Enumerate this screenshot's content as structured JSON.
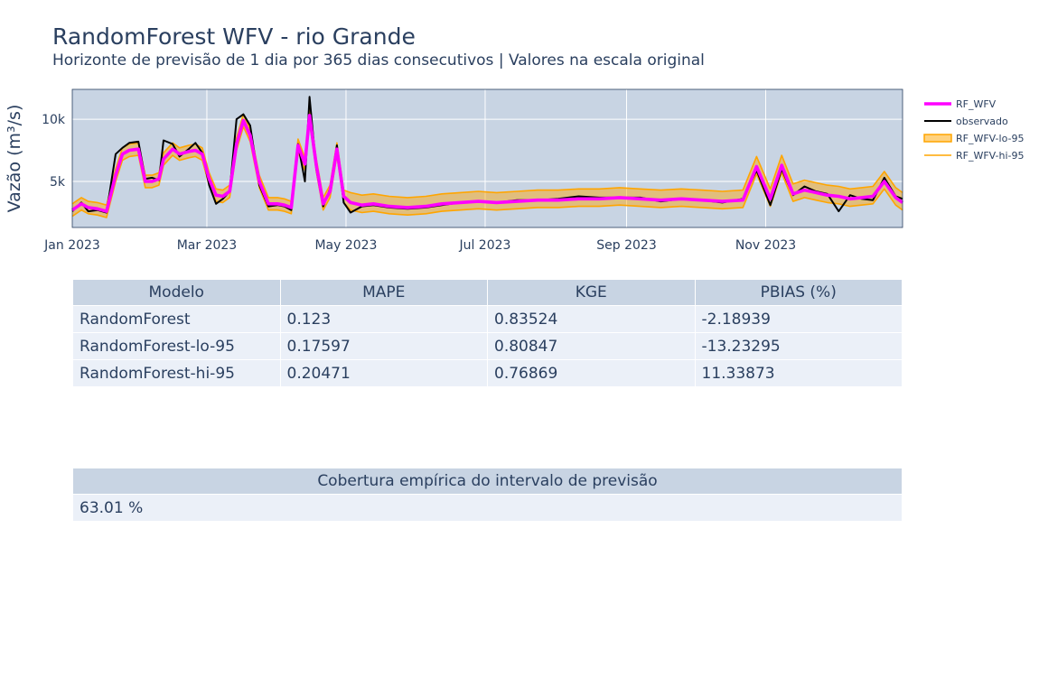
{
  "title": "RandomForest WFV - rio Grande",
  "subtitle": "Horizonte de previsão de 1 dia por 365 dias consecutivos | Valores na escala original",
  "chart_data": {
    "type": "line",
    "title": "RandomForest WFV - rio Grande",
    "subtitle": "Horizonte de previsão de 1 dia por 365 dias consecutivos | Valores na escala original",
    "ylabel": "Vazão (m³/s)",
    "xlabel": "",
    "x_range": [
      "2023-01-01",
      "2023-12-31"
    ],
    "ylim": [
      1300,
      12400
    ],
    "x_ticks": [
      {
        "date": "2023-01-01",
        "label": "Jan 2023"
      },
      {
        "date": "2023-03-01",
        "label": "Mar 2023"
      },
      {
        "date": "2023-05-01",
        "label": "May 2023"
      },
      {
        "date": "2023-07-01",
        "label": "Jul 2023"
      },
      {
        "date": "2023-09-01",
        "label": "Sep 2023"
      },
      {
        "date": "2023-11-01",
        "label": "Nov 2023"
      }
    ],
    "y_ticks": [
      {
        "value": 5000,
        "label": "5k"
      },
      {
        "value": 10000,
        "label": "10k"
      }
    ],
    "grid": true,
    "plot_background": "#c8d4e3",
    "legend_position": "right",
    "observed_dates": [
      "2023-01-01",
      "2023-01-05",
      "2023-01-08",
      "2023-01-12",
      "2023-01-16",
      "2023-01-20",
      "2023-01-23",
      "2023-01-26",
      "2023-01-30",
      "2023-02-02",
      "2023-02-05",
      "2023-02-08",
      "2023-02-10",
      "2023-02-14",
      "2023-02-17",
      "2023-02-21",
      "2023-02-24",
      "2023-02-27",
      "2023-03-02",
      "2023-03-05",
      "2023-03-08",
      "2023-03-11",
      "2023-03-14",
      "2023-03-17",
      "2023-03-20",
      "2023-03-24",
      "2023-03-28",
      "2023-04-01",
      "2023-04-04",
      "2023-04-07",
      "2023-04-10",
      "2023-04-13",
      "2023-04-15",
      "2023-04-18",
      "2023-04-21",
      "2023-04-24",
      "2023-04-27",
      "2023-04-30",
      "2023-05-03",
      "2023-05-08",
      "2023-05-13",
      "2023-05-20",
      "2023-05-28",
      "2023-06-05",
      "2023-06-12",
      "2023-06-20",
      "2023-06-28",
      "2023-07-06",
      "2023-07-15",
      "2023-07-24",
      "2023-08-02",
      "2023-08-11",
      "2023-08-20",
      "2023-08-29",
      "2023-09-07",
      "2023-09-16",
      "2023-09-25",
      "2023-10-04",
      "2023-10-13",
      "2023-10-22",
      "2023-10-28",
      "2023-11-03",
      "2023-11-08",
      "2023-11-13",
      "2023-11-18",
      "2023-11-23",
      "2023-11-28",
      "2023-12-03",
      "2023-12-08",
      "2023-12-13",
      "2023-12-18",
      "2023-12-23",
      "2023-12-28",
      "2023-12-31"
    ],
    "series": [
      {
        "name": "RF_WFV",
        "color": "#ff00ff",
        "values": [
          2700,
          3200,
          2900,
          2800,
          2600,
          5500,
          7200,
          7500,
          7600,
          5000,
          5000,
          5200,
          6800,
          7600,
          7200,
          7400,
          7500,
          7200,
          5200,
          3900,
          3800,
          4200,
          8000,
          9900,
          8700,
          5000,
          3200,
          3200,
          3100,
          2900,
          7900,
          6400,
          10300,
          6300,
          3200,
          4200,
          7600,
          3800,
          3300,
          3100,
          3200,
          3000,
          2900,
          3000,
          3200,
          3300,
          3400,
          3300,
          3400,
          3500,
          3500,
          3600,
          3600,
          3700,
          3600,
          3500,
          3600,
          3500,
          3400,
          3500,
          6200,
          3600,
          6300,
          4000,
          4300,
          4100,
          3900,
          3800,
          3600,
          3700,
          3800,
          5000,
          3700,
          3300
        ]
      },
      {
        "name": "observado",
        "color": "#000000",
        "values": [
          2600,
          3300,
          2600,
          2700,
          2500,
          7200,
          7700,
          8100,
          8200,
          5200,
          5300,
          5100,
          8300,
          8000,
          7000,
          7600,
          8100,
          7300,
          4700,
          3200,
          3600,
          4200,
          10000,
          10400,
          9500,
          4700,
          3000,
          3100,
          3000,
          2700,
          8000,
          5000,
          11800,
          6000,
          3000,
          4400,
          7900,
          3300,
          2500,
          3000,
          3100,
          2900,
          2800,
          2900,
          3100,
          3300,
          3400,
          3300,
          3500,
          3500,
          3600,
          3800,
          3700,
          3700,
          3700,
          3400,
          3600,
          3500,
          3300,
          3600,
          5900,
          3100,
          6000,
          3900,
          4600,
          4200,
          4000,
          2600,
          3900,
          3600,
          3500,
          5300,
          3800,
          3600
        ]
      },
      {
        "name": "RF_WFV-lo-95",
        "color": "#ffa500",
        "values": [
          2200,
          2700,
          2400,
          2300,
          2100,
          5000,
          6700,
          7000,
          7100,
          4500,
          4500,
          4700,
          6300,
          7100,
          6700,
          6900,
          7000,
          6700,
          4700,
          3400,
          3300,
          3700,
          7500,
          9400,
          8200,
          4500,
          2700,
          2700,
          2600,
          2400,
          7400,
          5900,
          9800,
          5800,
          2700,
          3700,
          7100,
          3300,
          2700,
          2500,
          2600,
          2400,
          2300,
          2400,
          2600,
          2700,
          2800,
          2700,
          2800,
          2900,
          2900,
          3000,
          3000,
          3100,
          3000,
          2900,
          3000,
          2900,
          2800,
          2900,
          5600,
          3000,
          5700,
          3400,
          3700,
          3500,
          3300,
          3200,
          3000,
          3100,
          3200,
          4400,
          3100,
          2700
        ]
      },
      {
        "name": "RF_WFV-hi-95",
        "color": "#ffa500",
        "values": [
          3200,
          3700,
          3400,
          3300,
          3100,
          6000,
          7700,
          8000,
          8100,
          5500,
          5500,
          5700,
          7300,
          8100,
          7700,
          7900,
          8000,
          7700,
          5700,
          4400,
          4300,
          4700,
          8500,
          10400,
          9200,
          5500,
          3700,
          3700,
          3600,
          3400,
          8400,
          6900,
          10800,
          6800,
          3700,
          4700,
          8100,
          4300,
          4100,
          3900,
          4000,
          3800,
          3700,
          3800,
          4000,
          4100,
          4200,
          4100,
          4200,
          4300,
          4300,
          4400,
          4400,
          4500,
          4400,
          4300,
          4400,
          4300,
          4200,
          4300,
          7000,
          4400,
          7100,
          4800,
          5100,
          4900,
          4700,
          4600,
          4400,
          4500,
          4600,
          5800,
          4500,
          4100
        ]
      }
    ]
  },
  "metrics_table": {
    "headers": [
      "Modelo",
      "MAPE",
      "KGE",
      "PBIAS (%)"
    ],
    "rows": [
      [
        "RandomForest",
        "0.123",
        "0.83524",
        "-2.18939"
      ],
      [
        "RandomForest-lo-95",
        "0.17597",
        "0.80847",
        "-13.23295"
      ],
      [
        "RandomForest-hi-95",
        "0.20471",
        "0.76869",
        "11.33873"
      ]
    ]
  },
  "coverage_table": {
    "header": "Cobertura empírica do intervalo de previsão",
    "value": "63.01 %"
  }
}
